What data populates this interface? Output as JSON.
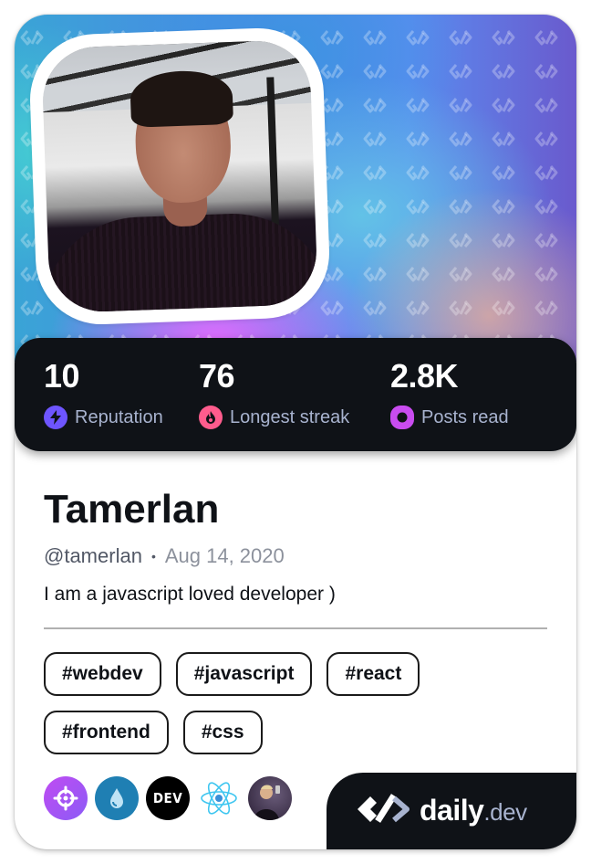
{
  "profile": {
    "name": "Tamerlan",
    "username": "@tamerlan",
    "separator": "•",
    "joined": "Aug 14, 2020",
    "bio": "I am a javascript loved developer )"
  },
  "stats": [
    {
      "value": "10",
      "label": "Reputation",
      "icon": "lightning-icon",
      "color": "#6e55ff"
    },
    {
      "value": "76",
      "label": "Longest streak",
      "icon": "flame-icon",
      "color": "#ff5c8d"
    },
    {
      "value": "2.8K",
      "label": "Posts read",
      "icon": "eye-icon",
      "color": "#c94cf0"
    }
  ],
  "tags": [
    "#webdev",
    "#javascript",
    "#react",
    "#frontend",
    "#css"
  ],
  "sources": [
    {
      "name": "crosshair-source",
      "color": "#a855f7"
    },
    {
      "name": "droplet-source",
      "color": "#1f7fb3"
    },
    {
      "name": "dev-source",
      "label": "DEV",
      "color": "#000000"
    },
    {
      "name": "react-source",
      "color": "#61dafb"
    },
    {
      "name": "person-source",
      "color": "#3a2a4a"
    }
  ],
  "brand": {
    "primary": "daily",
    "secondary": ".dev"
  },
  "colors": {
    "dark": "#0f1217",
    "muted": "#a8b3cf"
  }
}
